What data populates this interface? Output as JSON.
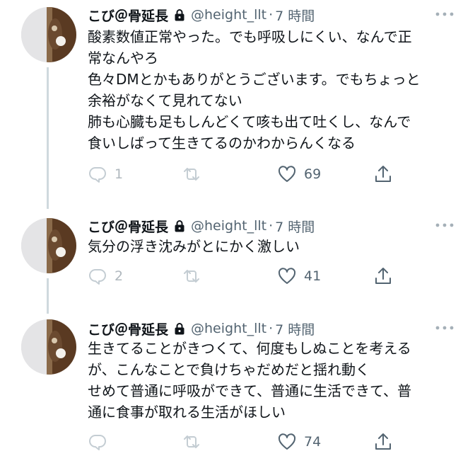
{
  "tweets": [
    {
      "name": "こび＠骨延長",
      "handle": "@height_llt",
      "separator": "·",
      "time": "7 時間",
      "lines": [
        "酸素数値正常やった。でも呼吸しにくい、なんで正",
        "常なんやろ",
        "色々DMとかもありがとうございます。でもちょっと",
        "余裕がなくて見れてない",
        "肺も心臓も足もしんどくて咳も出て吐くし、なんで",
        "食いしばって生きてるのかわからんくなる"
      ],
      "reply_count": "1",
      "retweet_count": "",
      "like_count": "69"
    },
    {
      "name": "こび＠骨延長",
      "handle": "@height_llt",
      "separator": "·",
      "time": "7 時間",
      "lines": [
        "気分の浮き沈みがとにかく激しい"
      ],
      "reply_count": "2",
      "retweet_count": "",
      "like_count": "41"
    },
    {
      "name": "こび＠骨延長",
      "handle": "@height_llt",
      "separator": "·",
      "time": "7 時間",
      "lines": [
        "生きてることがきつくて、何度もしぬことを考える",
        "が、こんなことで負けちゃだめだと揺れ動く",
        "せめて普通に呼吸ができて、普通に生活できて、普",
        "通に食事が取れる生活がほしい"
      ],
      "reply_count": "",
      "retweet_count": "",
      "like_count": "74"
    }
  ],
  "icons": {
    "lock": "lock-icon",
    "more": "more-icon",
    "reply": "reply-icon",
    "retweet": "retweet-icon",
    "like": "heart-icon",
    "share": "share-icon"
  },
  "colors": {
    "text": "#0f1419",
    "secondary": "#536471",
    "thread_line": "#cfd9de",
    "faint_icon": "#c4cdd3"
  }
}
